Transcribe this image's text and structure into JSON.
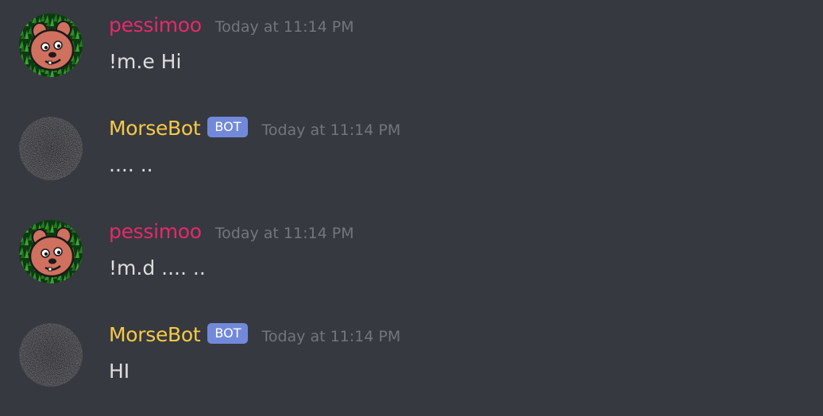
{
  "messages": [
    {
      "author": "pessimoo",
      "is_bot": false,
      "timestamp": "Today at 11:14 PM",
      "content": "!m.e Hi",
      "avatar": "bear-avatar"
    },
    {
      "author": "MorseBot",
      "is_bot": true,
      "bot_tag": "BOT",
      "timestamp": "Today at 11:14 PM",
      "content": ".... ..",
      "avatar": "static-noise-avatar"
    },
    {
      "author": "pessimoo",
      "is_bot": false,
      "timestamp": "Today at 11:14 PM",
      "content": "!m.d .... ..",
      "avatar": "bear-avatar"
    },
    {
      "author": "MorseBot",
      "is_bot": true,
      "bot_tag": "BOT",
      "timestamp": "Today at 11:14 PM",
      "content": "HI",
      "avatar": "static-noise-avatar"
    }
  ],
  "colors": {
    "background": "#36393f",
    "user_name": "#e32a6b",
    "bot_name": "#f7c948",
    "bot_tag": "#7289da",
    "timestamp": "#72767d",
    "message_text": "#dcddde"
  }
}
